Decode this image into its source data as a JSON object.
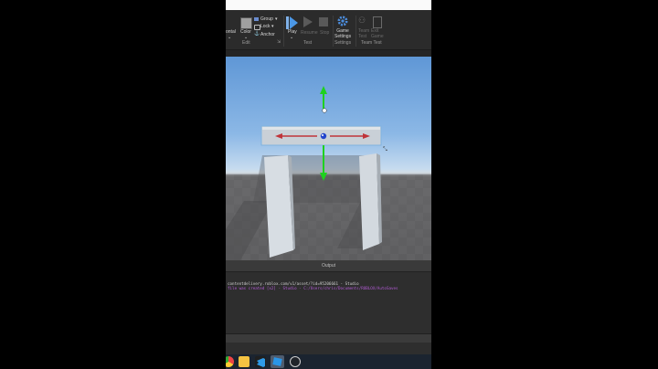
{
  "ribbon": {
    "partial_label": "ontal",
    "color_label": "Color",
    "group_label": "Group",
    "lock_label": "Lock",
    "anchor_label": "Anchor",
    "edit_group": "Edit",
    "play_label": "Play",
    "resume_label": "Resume",
    "stop_label": "Stop",
    "test_group": "Test",
    "game_settings_label": "Game\nSettings",
    "settings_group": "Settings",
    "team_test_label": "Team\nTest",
    "exit_game_label": "Exit\nGame",
    "team_test_group": "Team Test"
  },
  "output": {
    "title": "Output",
    "lines": [
      {
        "text": "contentdelivery.roblox.com/v1/asset/?id=95206661  -  Studio",
        "color": "#d0d0d0"
      },
      {
        "text": "file was created [x2]  -  Studio - C:/Users/chris/Documents/ROBLOX/AutoSaves",
        "color": "#b35bd6"
      }
    ]
  },
  "taskbar": {
    "icons": [
      "chrome-icon",
      "file-explorer-icon",
      "vscode-icon",
      "roblox-studio-icon",
      "obs-icon"
    ]
  },
  "colors": {
    "accent": "#3d8ee8",
    "gizmo_green": "#1fd11f",
    "gizmo_red": "#c0343a"
  }
}
